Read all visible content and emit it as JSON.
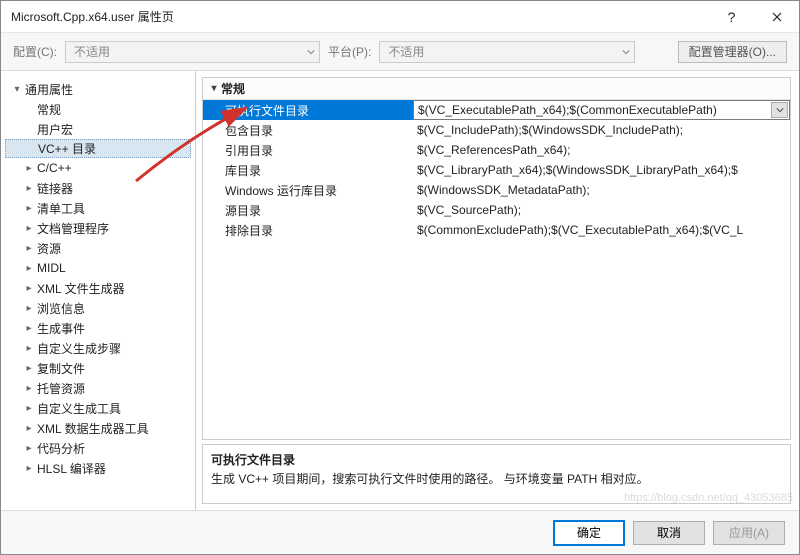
{
  "title": "Microsoft.Cpp.x64.user 属性页",
  "toolbar": {
    "config_label": "配置(C):",
    "config_value": "不适用",
    "platform_label": "平台(P):",
    "platform_value": "不适用",
    "config_manager": "配置管理器(O)..."
  },
  "tree": {
    "root": "通用属性",
    "items": [
      {
        "label": "常规",
        "expandable": false
      },
      {
        "label": "用户宏",
        "expandable": false
      },
      {
        "label": "VC++ 目录",
        "expandable": false,
        "selected": true
      },
      {
        "label": "C/C++",
        "expandable": true
      },
      {
        "label": "链接器",
        "expandable": true
      },
      {
        "label": "清单工具",
        "expandable": true
      },
      {
        "label": "文档管理程序",
        "expandable": true
      },
      {
        "label": "资源",
        "expandable": true
      },
      {
        "label": "MIDL",
        "expandable": true
      },
      {
        "label": "XML 文件生成器",
        "expandable": true
      },
      {
        "label": "浏览信息",
        "expandable": true
      },
      {
        "label": "生成事件",
        "expandable": true
      },
      {
        "label": "自定义生成步骤",
        "expandable": true
      },
      {
        "label": "复制文件",
        "expandable": true
      },
      {
        "label": "托管资源",
        "expandable": true
      },
      {
        "label": "自定义生成工具",
        "expandable": true
      },
      {
        "label": "XML 数据生成器工具",
        "expandable": true
      },
      {
        "label": "代码分析",
        "expandable": true
      },
      {
        "label": "HLSL 编译器",
        "expandable": true
      }
    ]
  },
  "grid": {
    "group": "常规",
    "rows": [
      {
        "k": "可执行文件目录",
        "v": "$(VC_ExecutablePath_x64);$(CommonExecutablePath)",
        "selected": true
      },
      {
        "k": "包含目录",
        "v": "$(VC_IncludePath);$(WindowsSDK_IncludePath);"
      },
      {
        "k": "引用目录",
        "v": "$(VC_ReferencesPath_x64);"
      },
      {
        "k": "库目录",
        "v": "$(VC_LibraryPath_x64);$(WindowsSDK_LibraryPath_x64);$"
      },
      {
        "k": "Windows 运行库目录",
        "v": "$(WindowsSDK_MetadataPath);"
      },
      {
        "k": "源目录",
        "v": "$(VC_SourcePath);"
      },
      {
        "k": "排除目录",
        "v": "$(CommonExcludePath);$(VC_ExecutablePath_x64);$(VC_L"
      }
    ]
  },
  "description": {
    "title": "可执行文件目录",
    "body": "生成 VC++ 项目期间，搜索可执行文件时使用的路径。    与环境变量 PATH 相对应。"
  },
  "footer": {
    "ok": "确定",
    "cancel": "取消",
    "apply": "应用(A)"
  },
  "watermark": "https://blog.csdn.net/qq_43053685"
}
